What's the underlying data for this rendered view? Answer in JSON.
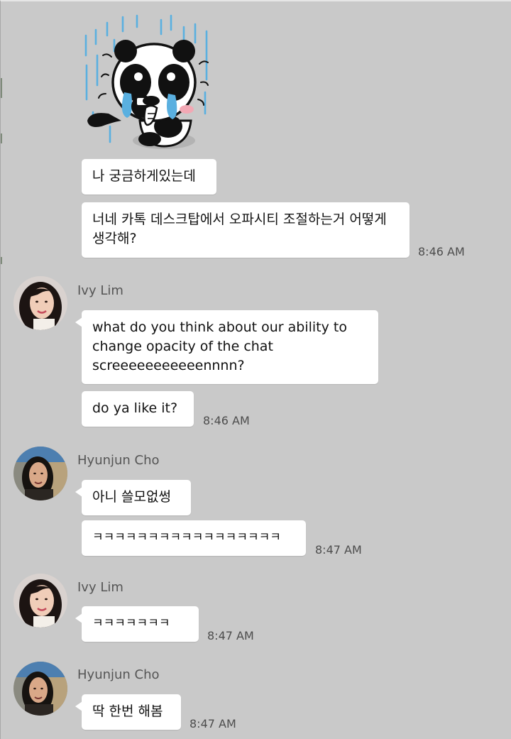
{
  "messages": {
    "m1": "나 궁금하게있는데",
    "m2": "너네 카톡 데스크탑에서 오파시티 조절하는거 어떻게 생각해?",
    "t1": "8:46 AM",
    "n1": "Ivy Lim",
    "m3": "what do you think about our ability to change opacity of the chat screeeeeeeeeeennnn?",
    "m4": "do ya like it?",
    "t2": "8:46 AM",
    "n2": "Hyunjun Cho",
    "m5": "아니 쓸모없썽",
    "m6": "ㅋㅋㅋㅋㅋㅋㅋㅋㅋㅋㅋㅋㅋㅋㅋㅋㅋ",
    "t3": "8:47 AM",
    "n3": "Ivy Lim",
    "m7": "ㅋㅋㅋㅋㅋㅋㅋ",
    "t4": "8:47 AM",
    "n4": "Hyunjun Cho",
    "m8": "딱 한번 해봄",
    "t5": "8:47 AM"
  },
  "colors": {
    "background": "#c9c9c9",
    "bubble": "#ffffff",
    "timestamp": "#4d4d4d",
    "sender_name": "#555555",
    "sticker_rain": "#5ab0e0"
  },
  "icons": {
    "sticker": "crying-panda-sticker",
    "avatar_ivy": "avatar-ivy-lim",
    "avatar_hyunjun": "avatar-hyunjun-cho"
  }
}
